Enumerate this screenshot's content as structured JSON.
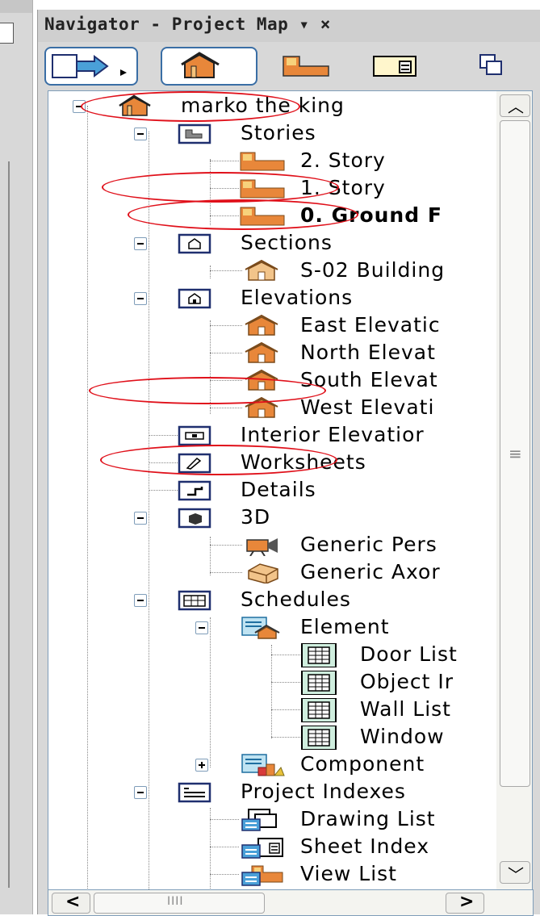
{
  "panel": {
    "title": "Navigator - Project Map ▾ ×",
    "close_glyph": "×"
  },
  "toolbar": {
    "buttons": [
      {
        "name": "publisher-set",
        "icon": "publish-arrow-icon"
      },
      {
        "name": "project-map",
        "icon": "house-icon",
        "active": true
      },
      {
        "name": "view-map",
        "icon": "story-icon"
      },
      {
        "name": "layout-book",
        "icon": "layout-icon"
      },
      {
        "name": "organizer",
        "icon": "organizer-icon"
      }
    ]
  },
  "tree": [
    {
      "label": "marko the king",
      "icon": "project-house-icon",
      "level": 0,
      "toggle": "minus"
    },
    {
      "label": "Stories",
      "icon": "stories-folder-icon",
      "level": 1,
      "toggle": "minus"
    },
    {
      "label": "2. Story",
      "icon": "story-icon",
      "level": 2
    },
    {
      "label": "1. Story",
      "icon": "story-icon",
      "level": 2
    },
    {
      "label": "0. Ground F",
      "icon": "story-icon",
      "level": 2,
      "bold": true
    },
    {
      "label": "Sections",
      "icon": "sections-folder-icon",
      "level": 1,
      "toggle": "minus"
    },
    {
      "label": "S-02 Building",
      "icon": "section-icon",
      "level": 2
    },
    {
      "label": "Elevations",
      "icon": "elevations-folder-icon",
      "level": 1,
      "toggle": "minus"
    },
    {
      "label": "East Elevatic",
      "icon": "elevation-icon",
      "level": 2
    },
    {
      "label": "North Elevat",
      "icon": "elevation-icon",
      "level": 2
    },
    {
      "label": "South Elevat",
      "icon": "elevation-icon",
      "level": 2
    },
    {
      "label": "West Elevati",
      "icon": "elevation-icon",
      "level": 2
    },
    {
      "label": "Interior Elevatior",
      "icon": "interior-elevation-folder-icon",
      "level": 1
    },
    {
      "label": "Worksheets",
      "icon": "worksheet-folder-icon",
      "level": 1
    },
    {
      "label": "Details",
      "icon": "details-folder-icon",
      "level": 1
    },
    {
      "label": "3D",
      "icon": "3d-folder-icon",
      "level": 1,
      "toggle": "minus"
    },
    {
      "label": "Generic Pers",
      "icon": "camera-icon",
      "level": 2
    },
    {
      "label": "Generic Axor",
      "icon": "axonometry-icon",
      "level": 2
    },
    {
      "label": "Schedules",
      "icon": "schedules-folder-icon",
      "level": 1,
      "toggle": "minus"
    },
    {
      "label": "Element",
      "icon": "element-schedule-icon",
      "level": 2,
      "toggle": "minus"
    },
    {
      "label": "Door List",
      "icon": "table-icon",
      "level": 3
    },
    {
      "label": "Object Ir",
      "icon": "table-icon",
      "level": 3
    },
    {
      "label": "Wall List",
      "icon": "table-icon",
      "level": 3
    },
    {
      "label": "Window",
      "icon": "table-icon",
      "level": 3
    },
    {
      "label": "Component",
      "icon": "component-schedule-icon",
      "level": 2,
      "toggle": "plus"
    },
    {
      "label": "Project Indexes",
      "icon": "project-indexes-folder-icon",
      "level": 1,
      "toggle": "minus"
    },
    {
      "label": "Drawing List",
      "icon": "drawing-list-icon",
      "level": 2
    },
    {
      "label": "Sheet Index",
      "icon": "sheet-index-icon",
      "level": 2
    },
    {
      "label": "View List",
      "icon": "view-list-icon",
      "level": 2
    }
  ],
  "scrollbars": {
    "vertical_grip": "≡",
    "horizontal_grip": "IIII",
    "up_arrow": "︿",
    "down_arrow": "﹀",
    "left_arrow": "<",
    "right_arrow": ">"
  },
  "colors": {
    "annotation": "#e0101a",
    "story_orange": "#e8873a",
    "folder_border": "#1f2f6f",
    "selection_blue": "#3a6ea5"
  }
}
